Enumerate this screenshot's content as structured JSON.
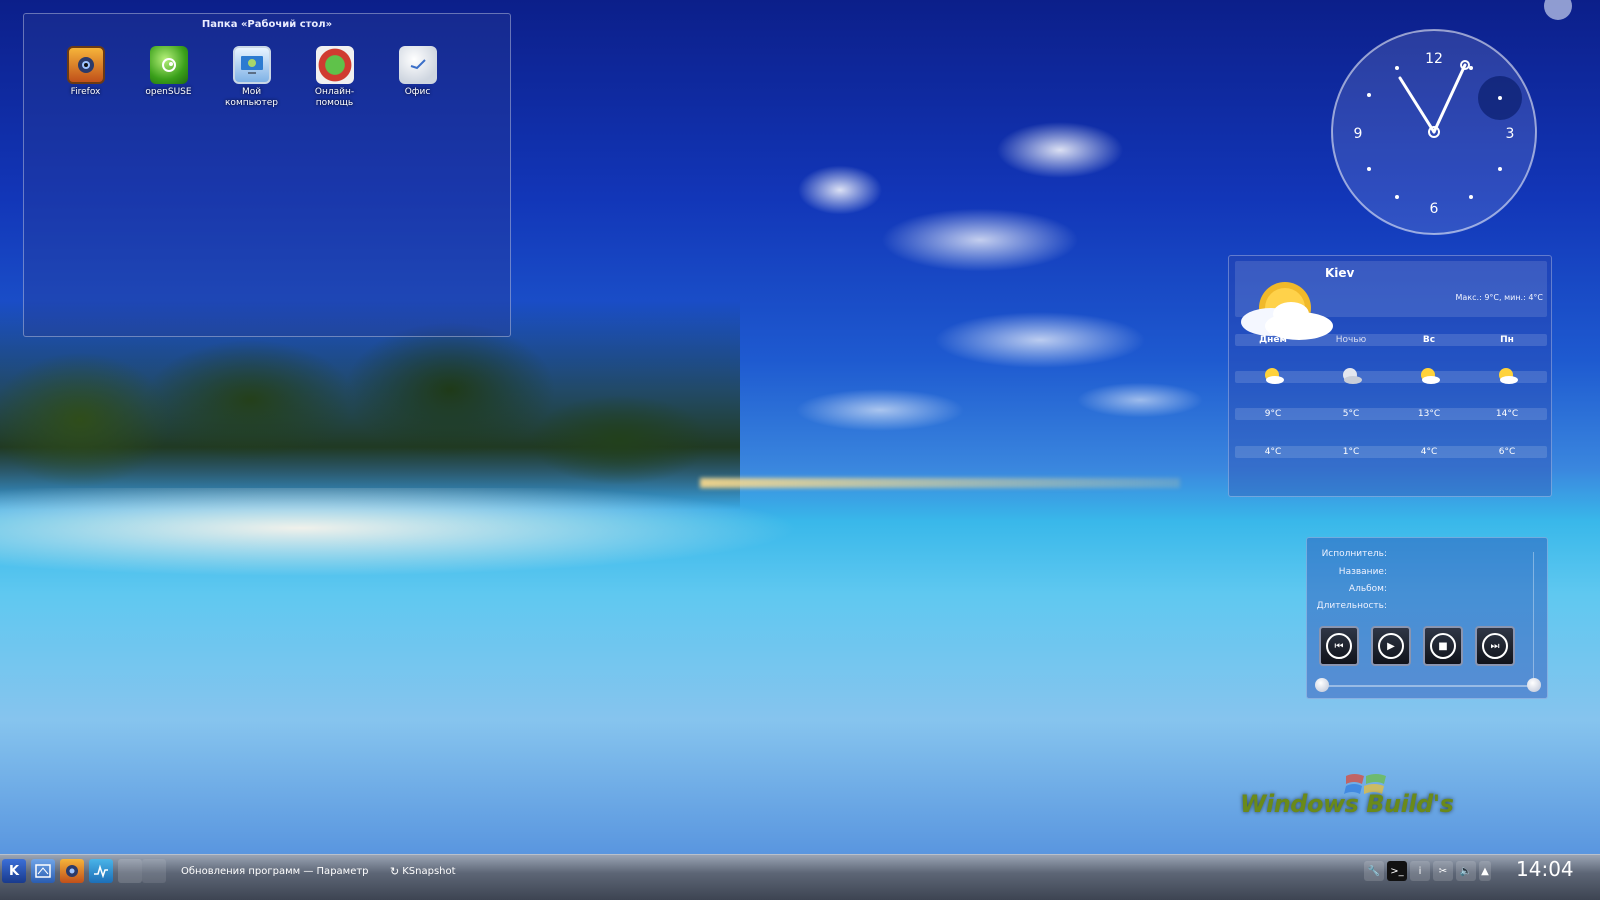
{
  "folder": {
    "title": "Папка «Рабочий стол»",
    "icons": [
      {
        "label": "Firefox",
        "icon": "firefox-icon"
      },
      {
        "label": "openSUSE",
        "icon": "opensuse-icon"
      },
      {
        "label": "Мой компьютер",
        "icon": "computer-icon"
      },
      {
        "label": "Онлайн-помощь",
        "icon": "lifebuoy-icon"
      },
      {
        "label": "Офис",
        "icon": "office-icon"
      }
    ]
  },
  "clock": {
    "numerals": [
      "12",
      "3",
      "6",
      "9"
    ],
    "time": "14:04"
  },
  "weather": {
    "city": "Kiev",
    "range": "Макс.: 9°C, мин.: 4°C",
    "columns": [
      {
        "label": "Днем",
        "high": "9°C",
        "low": "4°C"
      },
      {
        "label": "Ночью",
        "high": "5°C",
        "low": "1°C"
      },
      {
        "label": "Вс",
        "high": "13°C",
        "low": "4°C"
      },
      {
        "label": "Пн",
        "high": "14°C",
        "low": "6°C"
      }
    ]
  },
  "player": {
    "artist_label": "Исполнитель:",
    "title_label": "Название:",
    "album_label": "Альбом:",
    "duration_label": "Длительность:",
    "buttons": [
      "previous",
      "play",
      "stop",
      "next"
    ]
  },
  "watermark": "Windows Build's",
  "taskbar": {
    "tasks": [
      {
        "label": "Обновления программ — Параметры"
      },
      {
        "label": "KSnapshot"
      }
    ],
    "time": "14:04"
  },
  "colors": {
    "panel": "#5d6676",
    "accent": "#1e5ad0"
  }
}
